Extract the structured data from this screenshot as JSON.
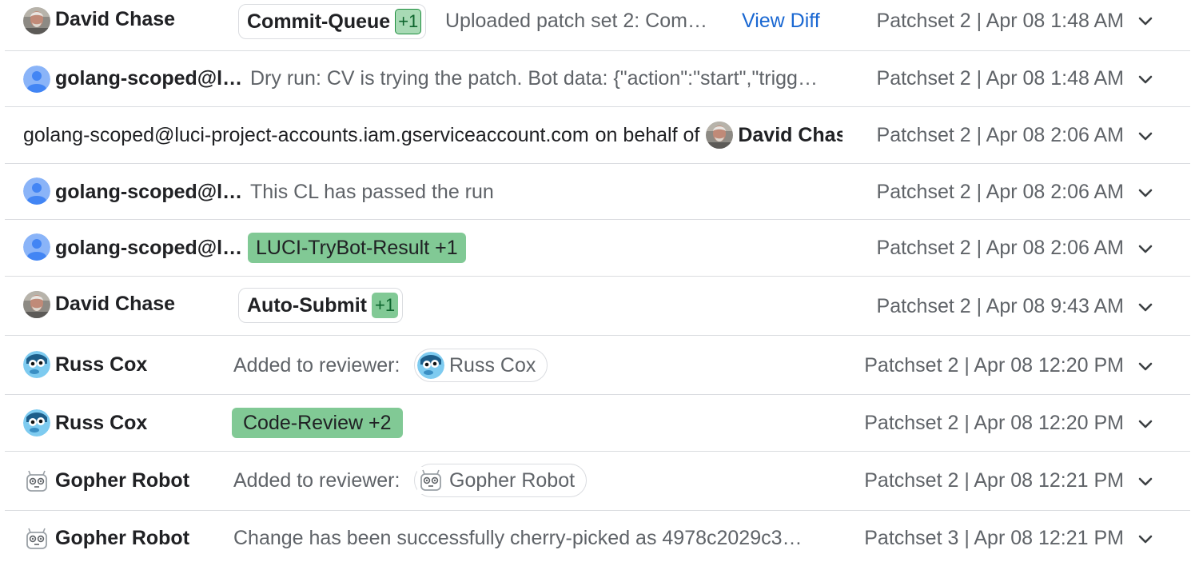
{
  "messages": [
    {
      "author": "David Chase",
      "vote_label": "Commit-Queue",
      "vote_value": "+1",
      "summary": "Uploaded patch set 2: Com…",
      "link": "View Diff",
      "date": "Patchset 2 | Apr 08 1:48 AM"
    },
    {
      "author": "golang-scoped@l…",
      "summary": "Dry run: CV is trying the patch. Bot data: {\"action\":\"start\",\"trigg…",
      "date": "Patchset 2 | Apr 08 1:48 AM"
    },
    {
      "account": "golang-scoped@luci-project-accounts.iam.gserviceaccount.com",
      "behalf_text": "on behalf of",
      "behalf_name": "David Chase",
      "date": "Patchset 2 | Apr 08 2:06 AM"
    },
    {
      "author": "golang-scoped@l…",
      "summary": "This CL has passed the run",
      "date": "Patchset 2 | Apr 08 2:06 AM"
    },
    {
      "author": "golang-scoped@l…",
      "chip": "LUCI-TryBot-Result +1",
      "date": "Patchset 2 | Apr 08 2:06 AM"
    },
    {
      "author": "David Chase",
      "vote_label": "Auto-Submit",
      "vote_value": "+1",
      "date": "Patchset 2 | Apr 08 9:43 AM"
    },
    {
      "author": "Russ Cox",
      "summary": "Added to reviewer:",
      "reviewer": "Russ Cox",
      "date": "Patchset 2 | Apr 08 12:20 PM"
    },
    {
      "author": "Russ Cox",
      "chip": "Code-Review +2",
      "date": "Patchset 2 | Apr 08 12:20 PM"
    },
    {
      "author": "Gopher Robot",
      "summary": "Added to reviewer:",
      "reviewer": "Gopher Robot",
      "date": "Patchset 2 | Apr 08 12:21 PM"
    },
    {
      "author": "Gopher Robot",
      "summary": "Change has been successfully cherry-picked as 4978c2029c3…",
      "date": "Patchset 3 | Apr 08 12:21 PM"
    }
  ],
  "icons": {
    "expand": "chevron-down-icon",
    "avatar_default": "person-icon",
    "avatar_photo": "user-photo-icon",
    "avatar_gopher": "gopher-robot-icon",
    "avatar_russ": "russ-avatar-icon"
  },
  "colors": {
    "chip_green": "#81c995",
    "link_blue": "#1967d2",
    "divider": "#dadce0",
    "default_avatar": "#8ab4f8"
  }
}
